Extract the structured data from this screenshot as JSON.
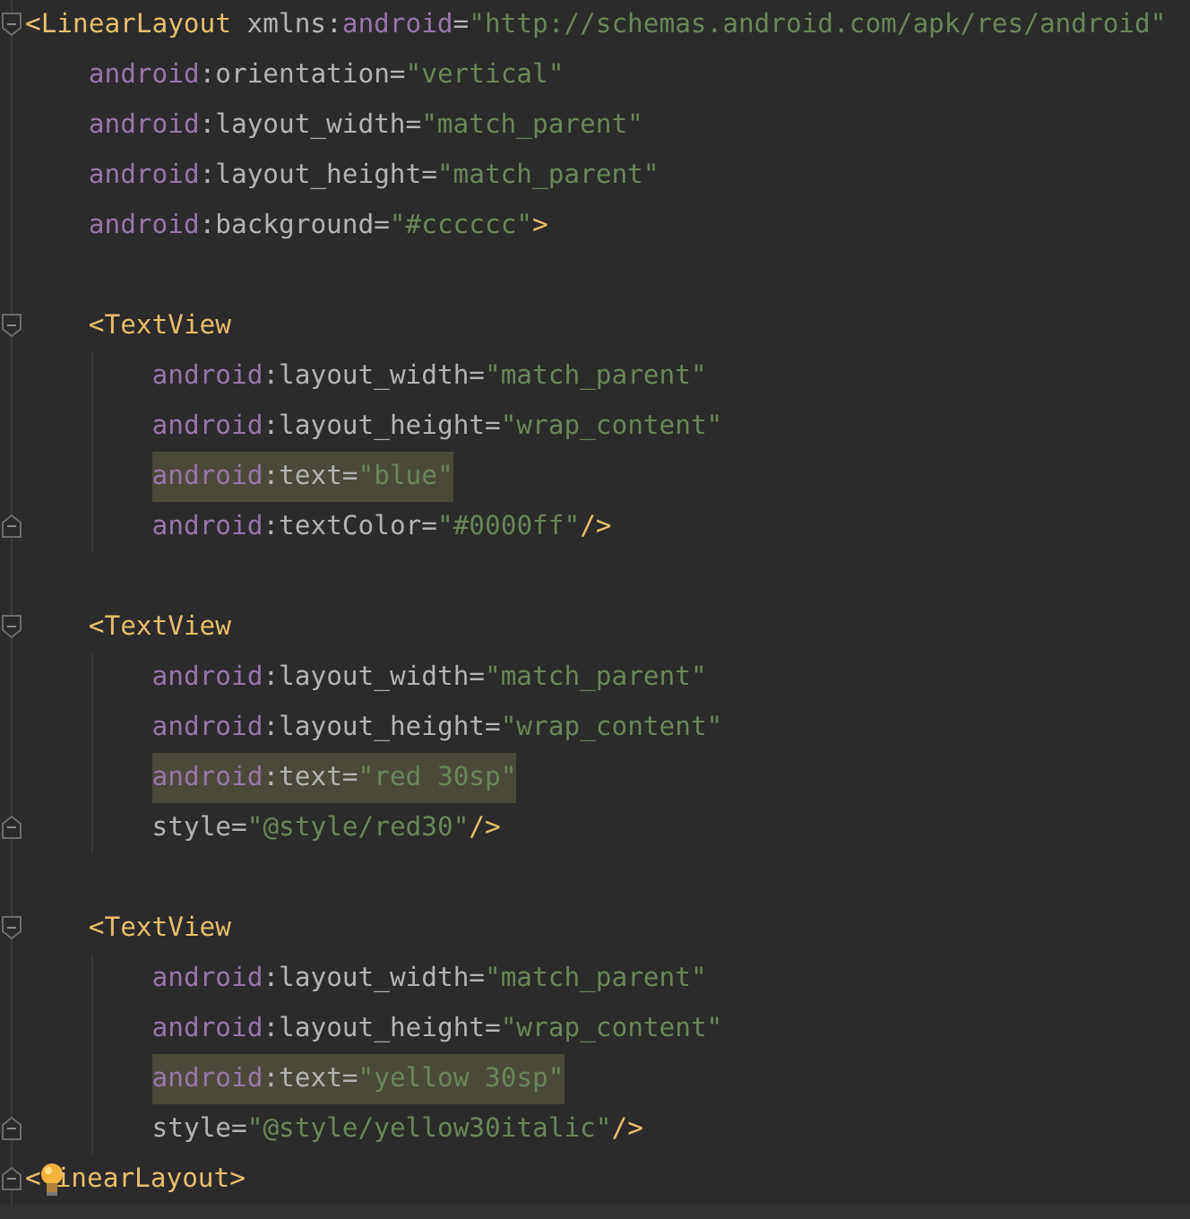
{
  "editor": {
    "lines": [
      {
        "kind": "code",
        "fold_start": true,
        "tokens": [
          {
            "kind": "tag",
            "text": "<LinearLayout"
          },
          {
            "kind": "plain",
            "text": " xmlns:"
          },
          {
            "kind": "ns",
            "text": "android"
          },
          {
            "kind": "plain",
            "text": "="
          },
          {
            "kind": "string",
            "text": "\"http://schemas.android.com/apk/res/android\""
          }
        ],
        "children": [
          {
            "kind": "code",
            "tokens": [
              {
                "kind": "ns",
                "text": "android"
              },
              {
                "kind": "plain",
                "text": ":orientation="
              },
              {
                "kind": "string",
                "text": "\"vertical\""
              }
            ]
          },
          {
            "kind": "code",
            "tokens": [
              {
                "kind": "ns",
                "text": "android"
              },
              {
                "kind": "plain",
                "text": ":layout_width="
              },
              {
                "kind": "string",
                "text": "\"match_parent\""
              }
            ]
          },
          {
            "kind": "code",
            "tokens": [
              {
                "kind": "ns",
                "text": "android"
              },
              {
                "kind": "plain",
                "text": ":layout_height="
              },
              {
                "kind": "string",
                "text": "\"match_parent\""
              }
            ]
          },
          {
            "kind": "code",
            "tokens": [
              {
                "kind": "ns",
                "text": "android"
              },
              {
                "kind": "plain",
                "text": ":background="
              },
              {
                "kind": "string",
                "text": "\"#cccccc\""
              },
              {
                "kind": "tag",
                "text": ">"
              }
            ]
          },
          {
            "kind": "blank"
          },
          {
            "kind": "code",
            "fold_start": true,
            "tokens": [
              {
                "kind": "tag",
                "text": "<TextView"
              }
            ],
            "children": [
              {
                "kind": "code",
                "tokens": [
                  {
                    "kind": "ns",
                    "text": "android"
                  },
                  {
                    "kind": "plain",
                    "text": ":layout_width="
                  },
                  {
                    "kind": "string",
                    "text": "\"match_parent\""
                  }
                ]
              },
              {
                "kind": "code",
                "tokens": [
                  {
                    "kind": "ns",
                    "text": "android"
                  },
                  {
                    "kind": "plain",
                    "text": ":layout_height="
                  },
                  {
                    "kind": "string",
                    "text": "\"wrap_content\""
                  }
                ]
              },
              {
                "kind": "code",
                "highlighted": true,
                "tokens": [
                  {
                    "kind": "ns",
                    "text": "android"
                  },
                  {
                    "kind": "plain",
                    "text": ":text="
                  },
                  {
                    "kind": "string",
                    "text": "\"blue\""
                  }
                ]
              },
              {
                "kind": "code",
                "fold_end": true,
                "tokens": [
                  {
                    "kind": "ns",
                    "text": "android"
                  },
                  {
                    "kind": "plain",
                    "text": ":textColor="
                  },
                  {
                    "kind": "string",
                    "text": "\"#0000ff\""
                  },
                  {
                    "kind": "tag",
                    "text": "/>"
                  }
                ]
              }
            ]
          },
          {
            "kind": "blank"
          },
          {
            "kind": "code",
            "fold_start": true,
            "tokens": [
              {
                "kind": "tag",
                "text": "<TextView"
              }
            ],
            "children": [
              {
                "kind": "code",
                "tokens": [
                  {
                    "kind": "ns",
                    "text": "android"
                  },
                  {
                    "kind": "plain",
                    "text": ":layout_width="
                  },
                  {
                    "kind": "string",
                    "text": "\"match_parent\""
                  }
                ]
              },
              {
                "kind": "code",
                "tokens": [
                  {
                    "kind": "ns",
                    "text": "android"
                  },
                  {
                    "kind": "plain",
                    "text": ":layout_height="
                  },
                  {
                    "kind": "string",
                    "text": "\"wrap_content\""
                  }
                ]
              },
              {
                "kind": "code",
                "highlighted": true,
                "tokens": [
                  {
                    "kind": "ns",
                    "text": "android"
                  },
                  {
                    "kind": "plain",
                    "text": ":text="
                  },
                  {
                    "kind": "string",
                    "text": "\"red 30sp\""
                  }
                ]
              },
              {
                "kind": "code",
                "fold_end": true,
                "tokens": [
                  {
                    "kind": "plain",
                    "text": "style="
                  },
                  {
                    "kind": "string",
                    "text": "\"@style/red30\""
                  },
                  {
                    "kind": "tag",
                    "text": "/>"
                  }
                ]
              }
            ]
          },
          {
            "kind": "blank"
          },
          {
            "kind": "code",
            "fold_start": true,
            "tokens": [
              {
                "kind": "tag",
                "text": "<TextView"
              }
            ],
            "children": [
              {
                "kind": "code",
                "tokens": [
                  {
                    "kind": "ns",
                    "text": "android"
                  },
                  {
                    "kind": "plain",
                    "text": ":layout_width="
                  },
                  {
                    "kind": "string",
                    "text": "\"match_parent\""
                  }
                ]
              },
              {
                "kind": "code",
                "tokens": [
                  {
                    "kind": "ns",
                    "text": "android"
                  },
                  {
                    "kind": "plain",
                    "text": ":layout_height="
                  },
                  {
                    "kind": "string",
                    "text": "\"wrap_content\""
                  }
                ]
              },
              {
                "kind": "code",
                "highlighted": true,
                "tokens": [
                  {
                    "kind": "ns",
                    "text": "android"
                  },
                  {
                    "kind": "plain",
                    "text": ":text="
                  },
                  {
                    "kind": "string",
                    "text": "\"yellow 30sp\""
                  }
                ]
              },
              {
                "kind": "code",
                "fold_end": true,
                "tokens": [
                  {
                    "kind": "plain",
                    "text": "style="
                  },
                  {
                    "kind": "string",
                    "text": "\"@style/yellow30italic\""
                  },
                  {
                    "kind": "tag",
                    "text": "/>"
                  }
                ]
              }
            ]
          }
        ]
      },
      {
        "kind": "code",
        "fold_end": true,
        "tokens": [
          {
            "kind": "tag",
            "text": "<"
          },
          {
            "kind": "bulb"
          },
          {
            "kind": "tag",
            "text": "inearLayout>"
          }
        ]
      }
    ]
  }
}
